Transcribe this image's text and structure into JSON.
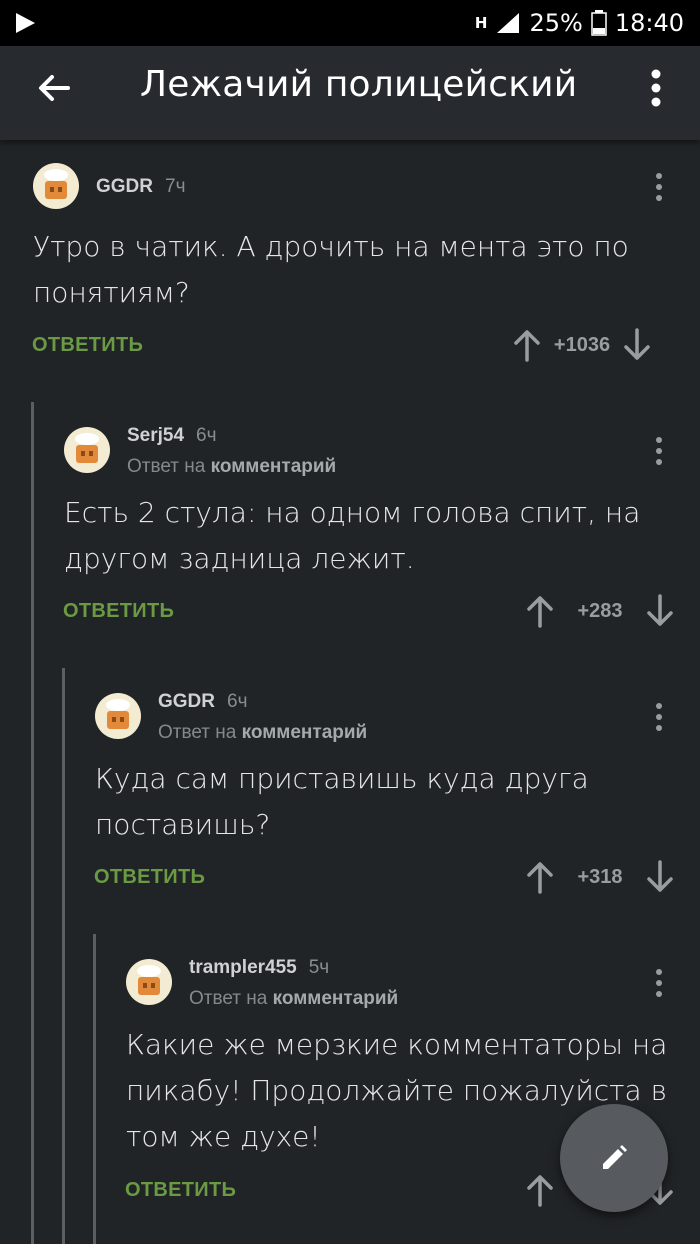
{
  "app_bar": {
    "title": "Лежачий полицейский"
  },
  "status_bar": {
    "network": "H",
    "battery": "25%",
    "time": "18:40"
  },
  "reply_to_prefix": "Ответ на",
  "reply_to_target": "комментарий",
  "reply_label": "ОТВЕТИТЬ",
  "comments": [
    {
      "author": "GGDR",
      "time": "7ч",
      "line1": "Утро в чатик. А дрочить на мента это по",
      "line2": "понятиям?",
      "score": "+1036"
    },
    {
      "author": "Serj54",
      "time": "6ч",
      "line1": "Есть 2 стула: на одном голова спит, на",
      "line2": "другом задница лежит.",
      "score": "+283"
    },
    {
      "author": "GGDR",
      "time": "6ч",
      "line1": "Куда сам приставишь куда друга",
      "line2": "поставишь?",
      "score": "+318"
    },
    {
      "author": "trampler455",
      "time": "5ч",
      "line1": "Какие же мерзкие комментаторы на",
      "line2": "пикабу! Продолжайте пожалуйста в",
      "line3": "том же духе!"
    }
  ],
  "icons": {
    "back": "arrow-left-icon",
    "more": "more-vertical-icon",
    "up": "arrow-up-icon",
    "down": "arrow-down-icon",
    "edit": "pencil-icon",
    "avatar": "default-avatar-icon"
  },
  "colors": {
    "background": "#212427",
    "app_bar": "#272b2f",
    "reply": "#6a9a43",
    "fab": "#575b5f"
  }
}
